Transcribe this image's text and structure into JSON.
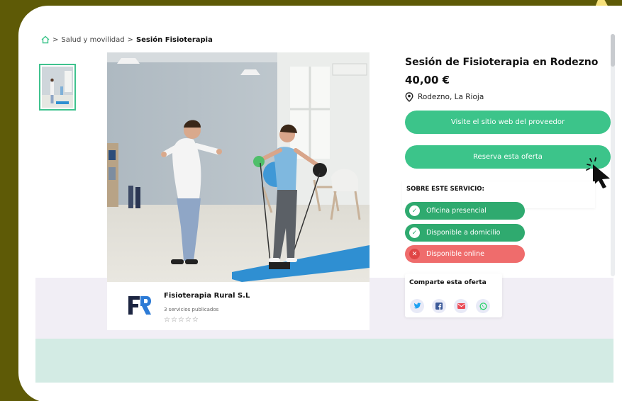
{
  "breadcrumb": {
    "separator": ">",
    "category": "Salud y movilidad",
    "current": "Sesión Fisioterapia"
  },
  "offer": {
    "title": "Sesión de Fisioterapia en Rodezno",
    "price": "40,00 €",
    "location": "Rodezno, La Rioja"
  },
  "buttons": {
    "visit_provider": "Visite el sitio web del proveedor",
    "book_offer": "Reserva esta oferta"
  },
  "service": {
    "title": "SOBRE ESTE SERVICIO:",
    "items": [
      {
        "label": "Oficina presencial",
        "available": true
      },
      {
        "label": "Disponible a domicilio",
        "available": true
      },
      {
        "label": "Disponible online",
        "available": false
      }
    ]
  },
  "provider": {
    "name": "Fisioterapia Rural S.L",
    "meta": "3 servicios publicados",
    "rating": 0,
    "stars": "☆☆☆☆☆",
    "logo_icon": "fr-logo"
  },
  "share": {
    "title": "Comparte esta oferta",
    "icons": [
      "twitter-icon",
      "facebook-icon",
      "email-icon",
      "whatsapp-icon"
    ]
  },
  "colors": {
    "accent_green": "#3cc48a",
    "pill_green": "#2faa6f",
    "pill_red": "#ef6c6c",
    "frame_bg": "#5e5a06",
    "mint_band": "#d3ebe4",
    "logo_navy": "#1c2541",
    "logo_blue": "#2d7bd6"
  }
}
